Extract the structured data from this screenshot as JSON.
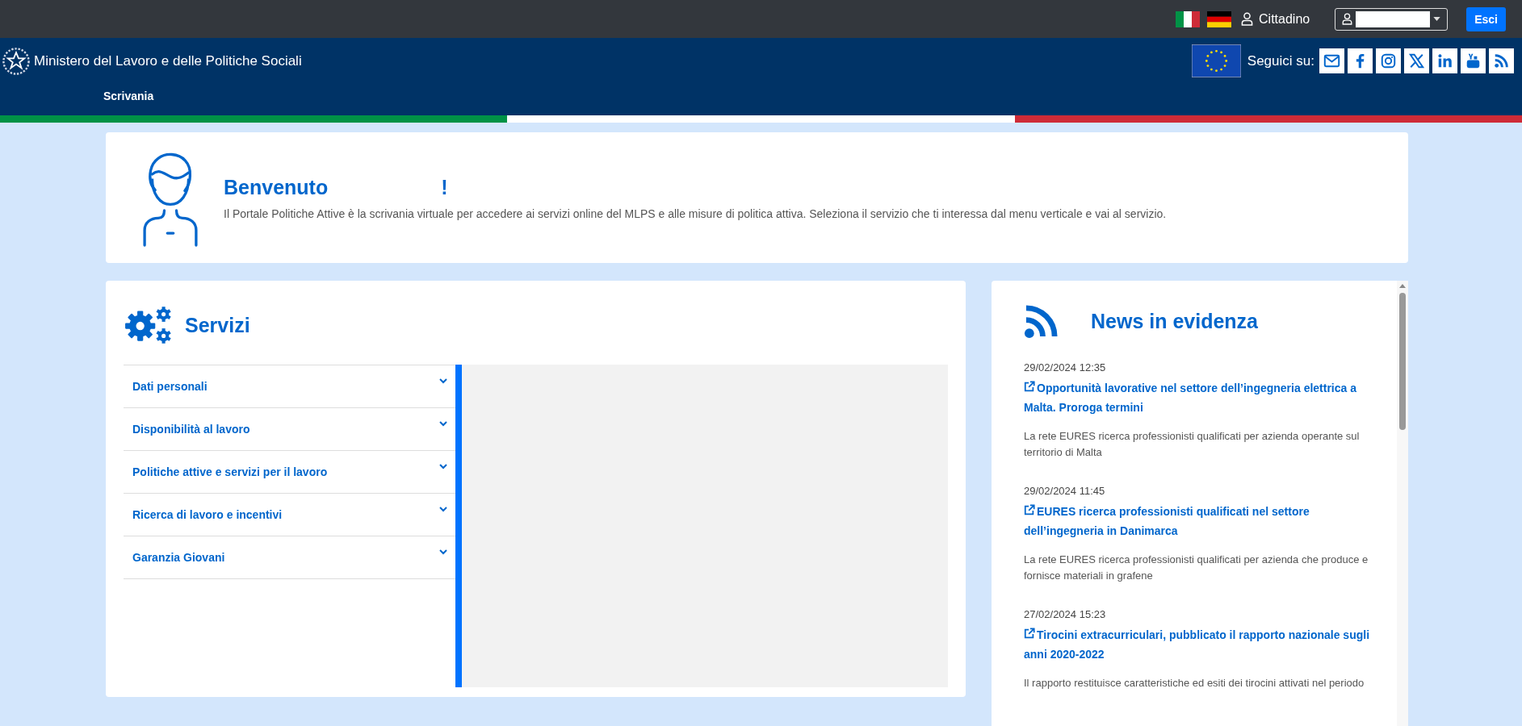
{
  "top_bar": {
    "languages": [
      {
        "kind": "it"
      },
      {
        "kind": "de"
      }
    ],
    "role": "Cittadino",
    "logout": "Esci"
  },
  "header": {
    "ministry": "Ministero del Lavoro e delle Politiche Sociali",
    "follow_label": "Seguici su:",
    "social": [
      {
        "kind": "mail"
      },
      {
        "kind": "facebook"
      },
      {
        "kind": "instagram"
      },
      {
        "kind": "x"
      },
      {
        "kind": "linkedin"
      },
      {
        "kind": "youtube"
      },
      {
        "kind": "rss"
      }
    ],
    "nav": [
      "Scrivania"
    ]
  },
  "welcome": {
    "title": "Benvenuto",
    "exclamation": "!",
    "text": "Il Portale Politiche Attive è la scrivania virtuale per accedere ai servizi online del MLPS e alle misure di politica attiva. Seleziona il servizio che ti interessa dal menu verticale e vai al servizio."
  },
  "services": {
    "title": "Servizi",
    "items": [
      {
        "label": "Dati personali",
        "expanded": false
      },
      {
        "label": "Disponibilità al lavoro",
        "expanded": false
      },
      {
        "label": "Politiche attive e servizi per il lavoro",
        "expanded": false
      },
      {
        "label": "Ricerca di lavoro e incentivi",
        "expanded": false
      },
      {
        "label": "Garanzia Giovani",
        "expanded": false
      }
    ]
  },
  "news": {
    "title": "News in evidenza",
    "items": [
      {
        "date": "29/02/2024 12:35",
        "title": "Opportunità lavorative nel settore dell’ingegneria elettrica a Malta. Proroga termini",
        "summary": "La rete EURES ricerca professionisti qualificati per azienda operante sul territorio di Malta"
      },
      {
        "date": "29/02/2024 11:45",
        "title": "EURES ricerca professionisti qualificati nel settore dell’ingegneria in Danimarca",
        "summary": "La rete EURES ricerca professionisti qualificati per azienda che produce e fornisce materiali in grafene"
      },
      {
        "date": "27/02/2024 15:23",
        "title": "Tirocini extracurriculari, pubblicato il rapporto nazionale sugli anni 2020-2022",
        "summary": "Il rapporto restituisce caratteristiche ed esiti dei tirocini attivati nel periodo"
      }
    ]
  }
}
